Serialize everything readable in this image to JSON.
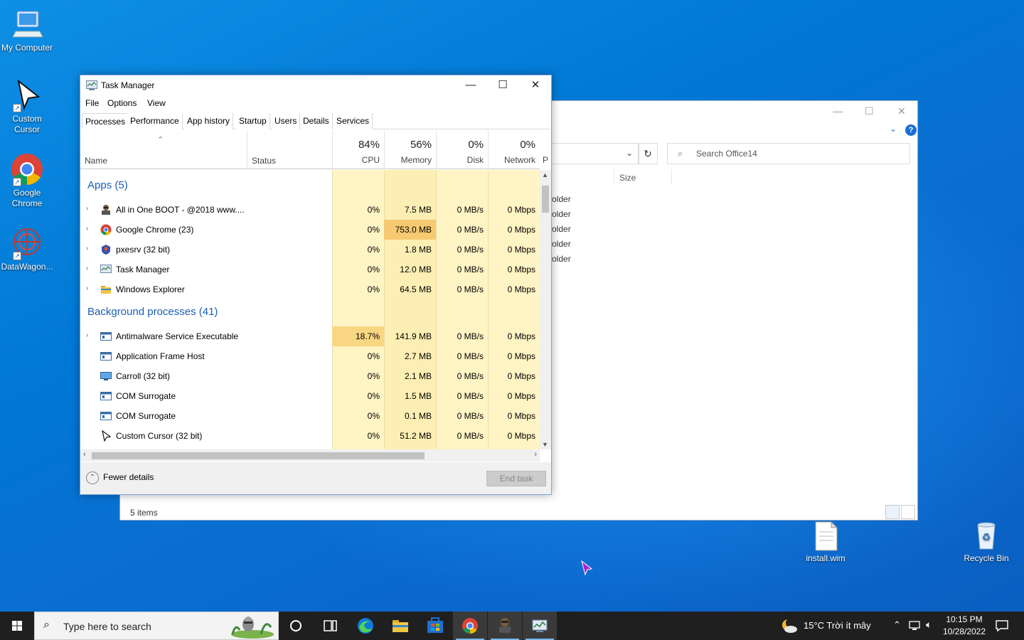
{
  "desktop": {
    "icons": [
      {
        "label": "My Computer"
      },
      {
        "label": "Custom Cursor"
      },
      {
        "label": "Google Chrome"
      },
      {
        "label": "DataWagon..."
      },
      {
        "label": "install.wim"
      },
      {
        "label": "Recycle Bin"
      }
    ]
  },
  "explorer": {
    "search_placeholder": "Search Office14",
    "column_size": "Size",
    "row_fragments": [
      "older",
      "older",
      "older",
      "older",
      "older"
    ],
    "status_items": "5 items"
  },
  "taskmanager": {
    "title": "Task Manager",
    "menu": [
      "File",
      "Options",
      "View"
    ],
    "tabs": [
      "Processes",
      "Performance",
      "App history",
      "Startup",
      "Users",
      "Details",
      "Services"
    ],
    "columns": {
      "name": "Name",
      "status": "Status",
      "cpu": {
        "pct": "84%",
        "label": "CPU"
      },
      "memory": {
        "pct": "56%",
        "label": "Memory"
      },
      "disk": {
        "pct": "0%",
        "label": "Disk"
      },
      "network": {
        "pct": "0%",
        "label": "Network"
      },
      "power_partial": "P"
    },
    "groups": {
      "apps": "Apps (5)",
      "background": "Background processes (41)"
    },
    "apps": [
      {
        "name": "All in One BOOT - @2018 www....",
        "cpu": "0%",
        "memory": "7.5 MB",
        "disk": "0 MB/s",
        "network": "0 Mbps"
      },
      {
        "name": "Google Chrome (23)",
        "cpu": "0%",
        "memory": "753.0 MB",
        "disk": "0 MB/s",
        "network": "0 Mbps"
      },
      {
        "name": "pxesrv (32 bit)",
        "cpu": "0%",
        "memory": "1.8 MB",
        "disk": "0 MB/s",
        "network": "0 Mbps"
      },
      {
        "name": "Task Manager",
        "cpu": "0%",
        "memory": "12.0 MB",
        "disk": "0 MB/s",
        "network": "0 Mbps"
      },
      {
        "name": "Windows Explorer",
        "cpu": "0%",
        "memory": "64.5 MB",
        "disk": "0 MB/s",
        "network": "0 Mbps"
      }
    ],
    "background": [
      {
        "name": "Antimalware Service Executable",
        "cpu": "18.7%",
        "memory": "141.9 MB",
        "disk": "0 MB/s",
        "network": "0 Mbps"
      },
      {
        "name": "Application Frame Host",
        "cpu": "0%",
        "memory": "2.7 MB",
        "disk": "0 MB/s",
        "network": "0 Mbps"
      },
      {
        "name": "Carroll (32 bit)",
        "cpu": "0%",
        "memory": "2.1 MB",
        "disk": "0 MB/s",
        "network": "0 Mbps"
      },
      {
        "name": "COM Surrogate",
        "cpu": "0%",
        "memory": "1.5 MB",
        "disk": "0 MB/s",
        "network": "0 Mbps"
      },
      {
        "name": "COM Surrogate",
        "cpu": "0%",
        "memory": "0.1 MB",
        "disk": "0 MB/s",
        "network": "0 Mbps"
      },
      {
        "name": "Custom Cursor (32 bit)",
        "cpu": "0%",
        "memory": "51.2 MB",
        "disk": "0 MB/s",
        "network": "0 Mbps"
      }
    ],
    "footer": {
      "fewer_details": "Fewer details",
      "end_task": "End task"
    }
  },
  "taskbar": {
    "search_placeholder": "Type here to search",
    "weather": "15°C  Trời ít mây",
    "time": "10:15 PM",
    "date": "10/28/2022"
  },
  "colors": {
    "accent": "#1a5fb4",
    "heat_light": "#fff4c4",
    "heat_mid": "#fde9a6",
    "heat_strong": "#f9d682",
    "heat_hot": "#f7c970"
  }
}
